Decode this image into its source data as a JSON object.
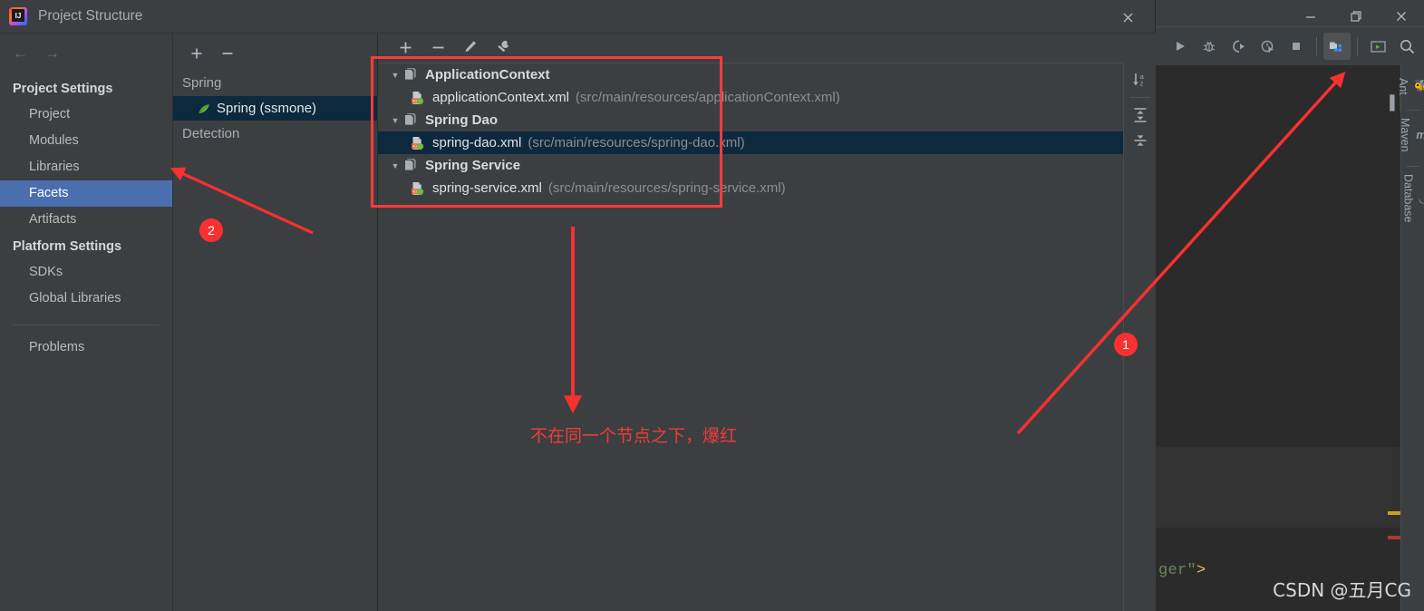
{
  "dialog": {
    "title": "Project Structure",
    "logo_icon": "intellij-idea-logo",
    "close_icon": "close-icon",
    "nav": {
      "back_icon": "arrow-left-icon",
      "forward_icon": "arrow-right-icon",
      "sections": [
        {
          "label": "Project Settings",
          "items": [
            {
              "label": "Project",
              "selected": false
            },
            {
              "label": "Modules",
              "selected": false
            },
            {
              "label": "Libraries",
              "selected": false
            },
            {
              "label": "Facets",
              "selected": true
            },
            {
              "label": "Artifacts",
              "selected": false
            }
          ]
        },
        {
          "label": "Platform Settings",
          "items": [
            {
              "label": "SDKs",
              "selected": false
            },
            {
              "label": "Global Libraries",
              "selected": false
            }
          ]
        }
      ],
      "footer_item": {
        "label": "Problems"
      }
    },
    "facets": {
      "toolbar": [
        {
          "icon": "add-icon",
          "label": "+"
        },
        {
          "icon": "remove-icon",
          "label": "−"
        }
      ],
      "group_header": "Spring",
      "items": [
        {
          "label": "Spring (ssmone)",
          "icon": "spring-leaf-icon",
          "selected": true
        }
      ],
      "detection_header": "Detection"
    },
    "detail": {
      "toolbar": [
        {
          "icon": "add-icon",
          "label": "+"
        },
        {
          "icon": "remove-icon",
          "label": "−"
        },
        {
          "icon": "edit-pencil-icon",
          "label": ""
        },
        {
          "icon": "wrench-icon",
          "label": ""
        }
      ],
      "side_toolbar": [
        {
          "icon": "sort-alphabetically-icon",
          "label": "↓az"
        },
        {
          "icon": "expand-all-icon",
          "label": ""
        },
        {
          "icon": "collapse-all-icon",
          "label": ""
        }
      ],
      "tree": [
        {
          "type": "group",
          "label": "ApplicationContext",
          "icon": "file-group-icon",
          "expanded": true,
          "twisty": "▼",
          "children": [
            {
              "type": "file",
              "icon": "spring-xml-file-icon",
              "name": "applicationContext.xml",
              "path": "(src/main/resources/applicationContext.xml)",
              "selected": false
            }
          ]
        },
        {
          "type": "group",
          "label": "Spring Dao",
          "icon": "file-group-icon",
          "expanded": true,
          "twisty": "▼",
          "children": [
            {
              "type": "file",
              "icon": "spring-xml-file-icon",
              "name": "spring-dao.xml",
              "path": "(src/main/resources/spring-dao.xml)",
              "selected": true
            }
          ]
        },
        {
          "type": "group",
          "label": "Spring Service",
          "icon": "file-group-icon",
          "expanded": true,
          "twisty": "▼",
          "children": [
            {
              "type": "file",
              "icon": "spring-xml-file-icon",
              "name": "spring-service.xml",
              "path": "(src/main/resources/spring-service.xml)",
              "selected": false
            }
          ]
        }
      ]
    }
  },
  "ide": {
    "toolbar": [
      {
        "icon": "run-icon",
        "active": false
      },
      {
        "icon": "debug-icon",
        "active": false
      },
      {
        "icon": "run-with-coverage-icon",
        "active": false
      },
      {
        "icon": "profiler-icon",
        "active": false
      },
      {
        "icon": "stop-icon",
        "active": false
      },
      {
        "icon": "project-structure-icon",
        "active": true
      },
      {
        "icon": "terminal-icon",
        "active": false
      },
      {
        "icon": "search-icon",
        "active": false
      }
    ],
    "window_controls": [
      {
        "icon": "minimize-icon",
        "label": "—"
      },
      {
        "icon": "restore-icon",
        "label": "❐"
      },
      {
        "icon": "close-icon",
        "label": "✕"
      }
    ],
    "right_rail": [
      {
        "label": "Ant",
        "icon": "ant-icon"
      },
      {
        "label": "Maven",
        "icon": "maven-icon"
      },
      {
        "label": "Database",
        "icon": "database-icon"
      }
    ],
    "pause_icon": "pause-icon",
    "editor": {
      "code_fragment_string": "ger\"",
      "code_fragment_tag": ">",
      "markers": [
        {
          "color": "#c9a026",
          "name": "warning-marker"
        },
        {
          "color": "#a33c36",
          "name": "error-marker"
        }
      ]
    }
  },
  "annotations": {
    "highlight_box_color": "#fb3b3b",
    "badges": [
      {
        "label": "1"
      },
      {
        "label": "2"
      }
    ],
    "note_text": "不在同一个节点之下，爆红",
    "watermark": "CSDN @五月CG"
  }
}
